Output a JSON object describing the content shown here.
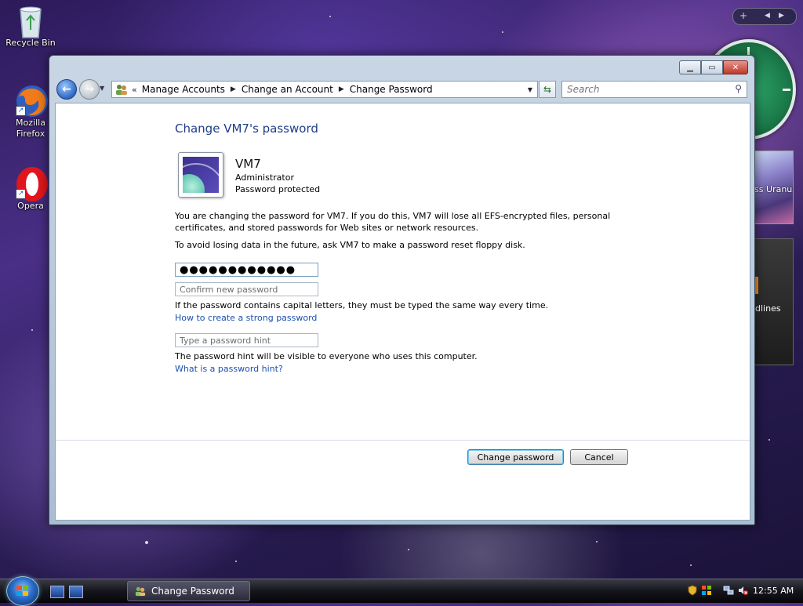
{
  "desktop": {
    "icons": [
      {
        "label": "Recycle Bin"
      },
      {
        "label": "Mozilla Firefox"
      },
      {
        "label": "Opera"
      }
    ],
    "gadgets": {
      "photo_label": "iss Uranus",
      "feed_label": "dlines"
    }
  },
  "window": {
    "breadcrumb": {
      "overflow": "«",
      "items": [
        "Manage Accounts",
        "Change an Account",
        "Change Password"
      ]
    },
    "search_placeholder": "Search",
    "title": "Change VM7's password",
    "user": {
      "name": "VM7",
      "role": "Administrator",
      "status": "Password protected"
    },
    "warning": "You are changing the password for VM7.  If you do this, VM7 will lose all EFS-encrypted files, personal certificates, and stored passwords for Web sites or network resources.",
    "advice": "To avoid losing data in the future, ask VM7 to make a password reset floppy disk.",
    "new_password_value": "●●●●●●●●●●●●",
    "confirm_placeholder": "Confirm new password",
    "capital_note": "If the password contains capital letters, they must be typed the same way every time.",
    "strong_link": "How to create a strong password",
    "hint_placeholder": "Type a password hint",
    "hint_note": "The password hint will be visible to everyone who uses this computer.",
    "hint_link": "What is a password hint?",
    "buttons": {
      "change": "Change password",
      "cancel": "Cancel"
    }
  },
  "taskbar": {
    "task_label": "Change Password",
    "clock": "12:55 AM"
  }
}
